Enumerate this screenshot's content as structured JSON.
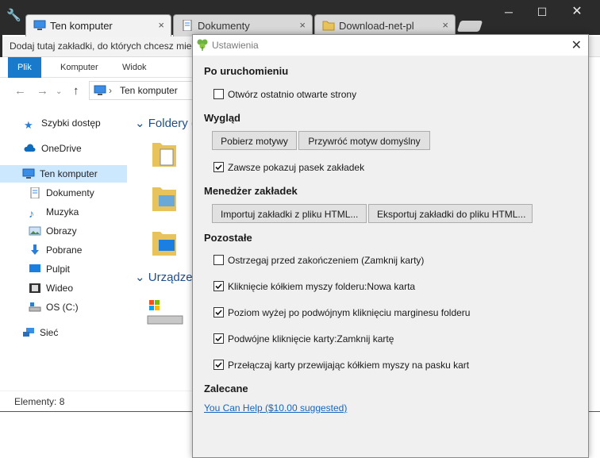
{
  "browser": {
    "tabs": [
      {
        "label": "Ten komputer",
        "active": true
      },
      {
        "label": "Dokumenty",
        "active": false
      },
      {
        "label": "Download-net-pl",
        "active": false
      }
    ],
    "close_glyph": "×",
    "bookmark_prompt": "Dodaj tutaj zakładki, do których chcesz mieć"
  },
  "explorer": {
    "ribbon_tabs": [
      "Plik",
      "Komputer",
      "Widok"
    ],
    "address": "Ten komputer",
    "sidebar": [
      {
        "label": "Szybki dostęp",
        "icon": "star-icon"
      },
      {
        "label": "OneDrive",
        "icon": "cloud-icon"
      },
      {
        "label": "Ten komputer",
        "icon": "computer-icon",
        "selected": true
      },
      {
        "label": "Dokumenty",
        "icon": "document-icon"
      },
      {
        "label": "Muzyka",
        "icon": "music-icon"
      },
      {
        "label": "Obrazy",
        "icon": "picture-icon"
      },
      {
        "label": "Pobrane",
        "icon": "download-icon"
      },
      {
        "label": "Pulpit",
        "icon": "desktop-icon"
      },
      {
        "label": "Wideo",
        "icon": "video-icon"
      },
      {
        "label": "OS (C:)",
        "icon": "drive-icon"
      },
      {
        "label": "Sieć",
        "icon": "network-icon"
      }
    ],
    "group_folders": "Foldery (",
    "group_devices": "Urządzen",
    "status": "Elementy: 8"
  },
  "dialog": {
    "title": "Ustawienia",
    "close_glyph": "✕",
    "sections": {
      "startup": "Po uruchomieniu",
      "appearance": "Wygląd",
      "bookmarks": "Menedżer zakładek",
      "other": "Pozostałe",
      "recommended": "Zalecane"
    },
    "options": {
      "restore_pages": {
        "label": "Otwórz ostatnio otwarte strony",
        "checked": false
      },
      "show_bookmarks_bar": {
        "label": "Zawsze pokazuj pasek zakładek",
        "checked": true
      },
      "warn_before_close": {
        "label": "Ostrzegaj przed zakończeniem (Zamknij karty)",
        "checked": false
      },
      "middle_click_folder": {
        "label": "Kliknięcie kółkiem myszy folderu:Nowa karta",
        "checked": true
      },
      "double_click_up": {
        "label": "Poziom wyżej po podwójnym kliknięciu marginesu folderu",
        "checked": true
      },
      "double_click_tab": {
        "label": "Podwójne kliknięcie karty:Zamknij kartę",
        "checked": true
      },
      "wheel_switch_tabs": {
        "label": "Przełączaj karty przewijając kółkiem myszy na pasku kart",
        "checked": true
      }
    },
    "buttons": {
      "get_themes": "Pobierz motywy",
      "restore_theme": "Przywróć motyw domyślny",
      "import_bookmarks": "Importuj zakładki z pliku HTML...",
      "export_bookmarks": "Eksportuj zakładki do pliku HTML..."
    },
    "help_link": "You Can Help ($10.00 suggested)"
  },
  "colors": {
    "accent": "#1979ca",
    "link": "#1565c0",
    "selection": "#cce8ff"
  }
}
